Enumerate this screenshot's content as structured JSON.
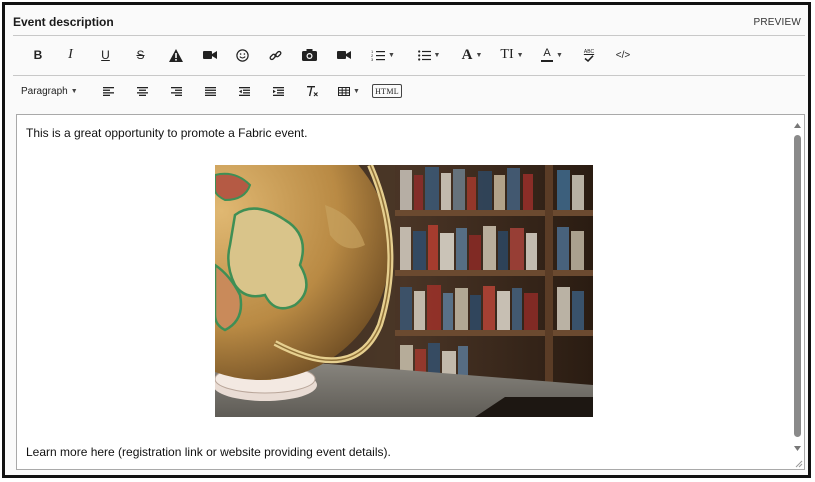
{
  "header": {
    "title": "Event description",
    "preview_label": "PREVIEW"
  },
  "toolbar": {
    "row1": [
      {
        "name": "bold-button",
        "icon": "bold-icon",
        "glyph": "B"
      },
      {
        "name": "italic-button",
        "icon": "italic-icon",
        "glyph": "I"
      },
      {
        "name": "underline-button",
        "icon": "underline-icon",
        "glyph": "U"
      },
      {
        "name": "strikethrough-button",
        "icon": "strikethrough-icon",
        "glyph": "S"
      },
      {
        "name": "warning-button",
        "icon": "warning-icon"
      },
      {
        "name": "video-button",
        "icon": "video-camera-icon"
      },
      {
        "name": "emoji-button",
        "icon": "smiley-icon"
      },
      {
        "name": "link-button",
        "icon": "link-icon"
      },
      {
        "name": "image-button",
        "icon": "camera-icon"
      },
      {
        "name": "media-button",
        "icon": "video-camera-icon"
      },
      {
        "name": "ordered-list-button",
        "icon": "numbered-list-icon"
      },
      {
        "name": "bullet-list-button",
        "icon": "bulleted-list-icon"
      },
      {
        "name": "font-family-button",
        "icon": "font-icon",
        "glyph": "A"
      },
      {
        "name": "font-size-button",
        "icon": "text-size-icon",
        "glyph": "TI"
      },
      {
        "name": "font-color-button",
        "icon": "font-color-icon",
        "glyph": "A"
      },
      {
        "name": "spellcheck-button",
        "icon": "spellcheck-icon",
        "glyph": "ABC"
      },
      {
        "name": "code-view-button",
        "icon": "code-icon",
        "glyph": "</>"
      }
    ],
    "row2": {
      "paragraph_label": "Paragraph",
      "html_label": "HTML"
    }
  },
  "editor": {
    "intro_text": "This is a great opportunity to promote a Fabric event.",
    "footer_text": "Learn more here (registration link or website providing event details).",
    "image_description": "globe-on-desk-in-library-photo"
  },
  "colors": {
    "frame_border": "#111111",
    "divider": "#c8c8c8",
    "editor_border": "#a9a9a9",
    "scroll_thumb": "#8a8a8a",
    "font_color_underline": "#222222"
  }
}
